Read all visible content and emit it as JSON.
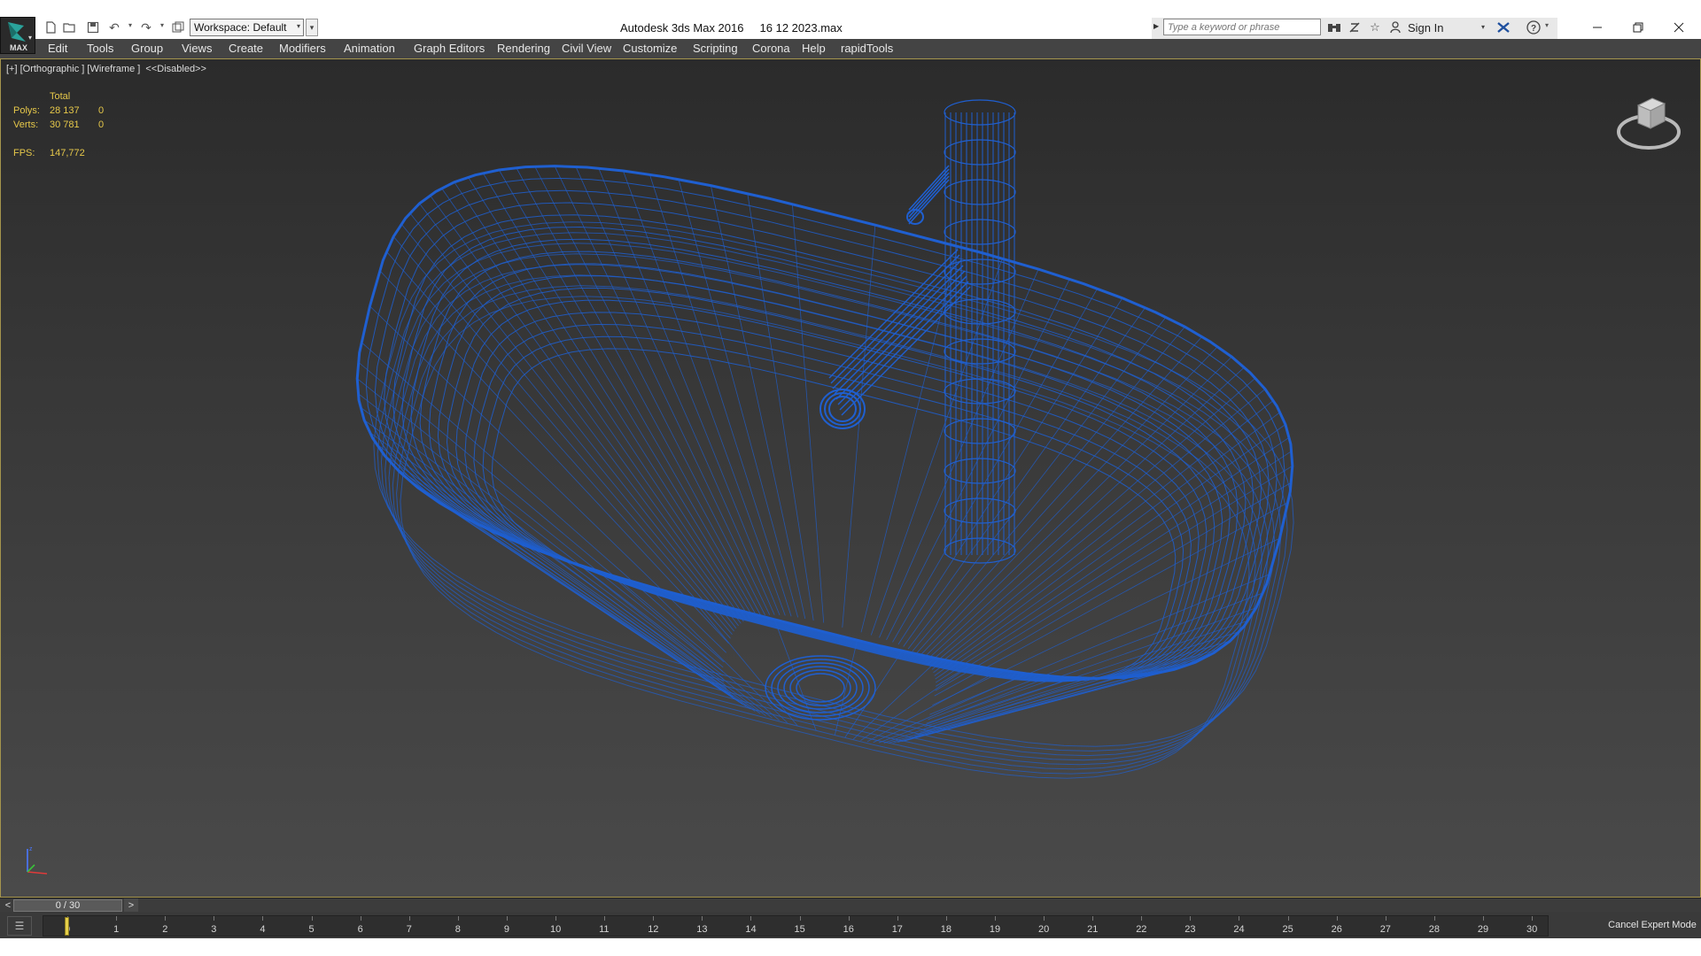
{
  "window": {
    "title": "Autodesk 3ds Max 2016     16 12 2023.max"
  },
  "app": {
    "logo_text": "MAX"
  },
  "toolbar": {
    "workspace": "Workspace: Default"
  },
  "search": {
    "placeholder": "Type a keyword or phrase"
  },
  "account": {
    "sign_in": "Sign In"
  },
  "menu": [
    "Edit",
    "Tools",
    "Group",
    "Views",
    "Create",
    "Modifiers",
    "Animation",
    "Graph Editors",
    "Rendering",
    "Civil View",
    "Customize",
    "Scripting",
    "Corona",
    "Help",
    "rapidTools"
  ],
  "viewport": {
    "label": "[+] [Orthographic ] [Wireframe ]  <<Disabled>>",
    "stats": {
      "header": "Total",
      "polys_label": "Polys:",
      "polys_total": "28 137",
      "polys_sel": "0",
      "verts_label": "Verts:",
      "verts_total": "30 781",
      "verts_sel": "0",
      "fps_label": "FPS:",
      "fps_value": "147,772"
    },
    "wire_color": "#1f5fd0"
  },
  "timeslider": {
    "prev": "<",
    "position": "0 / 30",
    "next": ">"
  },
  "trackbar": {
    "ticks": [
      "0",
      "1",
      "2",
      "3",
      "4",
      "5",
      "6",
      "7",
      "8",
      "9",
      "10",
      "11",
      "12",
      "13",
      "14",
      "15",
      "16",
      "17",
      "18",
      "19",
      "20",
      "21",
      "22",
      "23",
      "24",
      "25",
      "26",
      "27",
      "28",
      "29",
      "30"
    ],
    "current_frame": 0
  },
  "expert_mode": {
    "label": "Cancel Expert Mode"
  }
}
